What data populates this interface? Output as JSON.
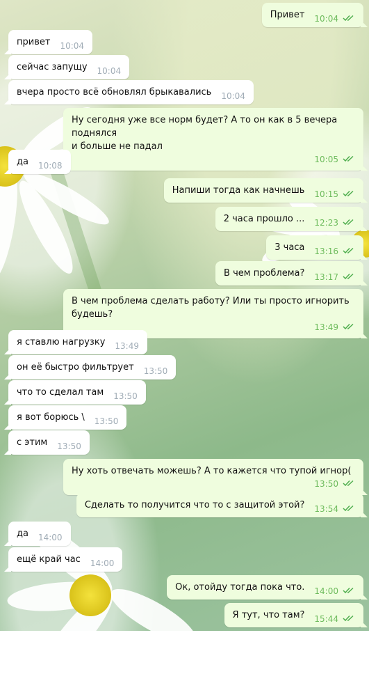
{
  "colors": {
    "incoming_bubble": "#ffffff",
    "outgoing_bubble": "#effdde",
    "outgoing_time": "#6dbb5c",
    "incoming_time": "#a0acb6",
    "read_check": "#4fae4e"
  },
  "messages": [
    {
      "dir": "out",
      "text": "Привет",
      "time": "10:04",
      "status_icon": "double-check-icon"
    },
    {
      "dir": "in",
      "text": "привет",
      "time": "10:04"
    },
    {
      "dir": "in",
      "text": "сейчас запущу",
      "time": "10:04"
    },
    {
      "dir": "in",
      "text": "вчера просто всё обновлял брыкавались",
      "time": "10:04"
    },
    {
      "dir": "out",
      "text": "Ну сегодня уже все норм будет? А то он как в 5 вечера поднялся\nи больше не падал",
      "time": "10:05",
      "status_icon": "double-check-icon"
    },
    {
      "dir": "in",
      "text": "да",
      "time": "10:08"
    },
    {
      "dir": "out",
      "text": "Напиши тогда как начнешь",
      "time": "10:15",
      "status_icon": "double-check-icon"
    },
    {
      "dir": "out",
      "text": "2 часа прошло ...",
      "time": "12:23",
      "status_icon": "double-check-icon"
    },
    {
      "dir": "out",
      "text": "3 часа",
      "time": "13:16",
      "status_icon": "double-check-icon"
    },
    {
      "dir": "out",
      "text": "В чем проблема?",
      "time": "13:17",
      "status_icon": "double-check-icon"
    },
    {
      "dir": "out",
      "text": "В чем проблема сделать работу? Или ты просто игнорить\nбудешь?",
      "time": "13:49",
      "status_icon": "double-check-icon"
    },
    {
      "dir": "in",
      "text": "я ставлю нагрузку",
      "time": "13:49"
    },
    {
      "dir": "in",
      "text": "он её быстро фильтрует",
      "time": "13:50"
    },
    {
      "dir": "in",
      "text": "что то сделал там",
      "time": "13:50"
    },
    {
      "dir": "in",
      "text": "я вот борюсь \\",
      "time": "13:50"
    },
    {
      "dir": "in",
      "text": "с этим",
      "time": "13:50"
    },
    {
      "dir": "out",
      "text": "Ну хоть отвечать можешь? А то кажется что тупой игнор(",
      "time": "13:50",
      "status_icon": "double-check-icon"
    },
    {
      "dir": "out",
      "text": "Сделать то получится что то с защитой этой?",
      "time": "13:54",
      "status_icon": "double-check-icon"
    },
    {
      "dir": "in",
      "text": "да",
      "time": "14:00"
    },
    {
      "dir": "in",
      "text": "ещё край час",
      "time": "14:00"
    },
    {
      "dir": "out",
      "text": "Ок, отойду тогда пока что.",
      "time": "14:00",
      "status_icon": "double-check-icon"
    },
    {
      "dir": "out",
      "text": "Я тут, что там?",
      "time": "15:44",
      "status_icon": "double-check-icon"
    }
  ]
}
